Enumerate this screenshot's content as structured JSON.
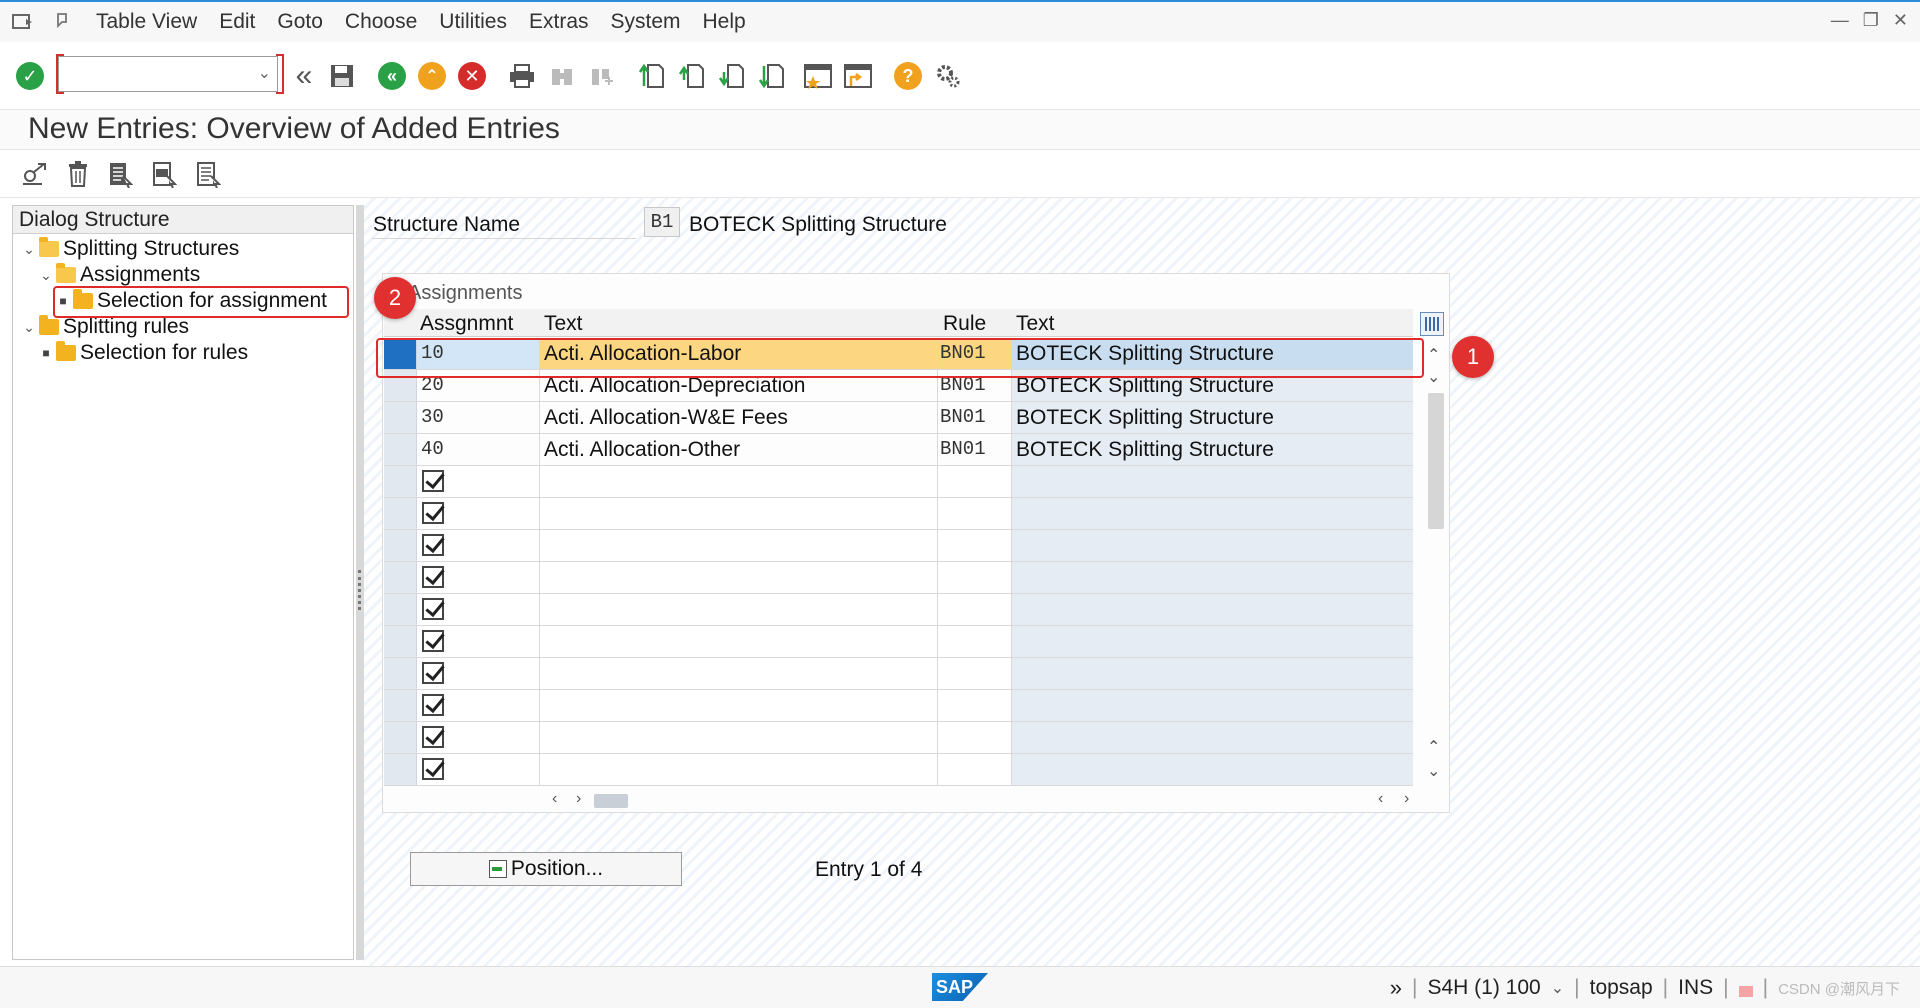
{
  "menu": {
    "items": [
      {
        "label": "Table View"
      },
      {
        "label": "Edit"
      },
      {
        "label": "Goto"
      },
      {
        "label": "Choose"
      },
      {
        "label": "Utilities"
      },
      {
        "label": "Extras"
      },
      {
        "label": "System"
      },
      {
        "label": "Help"
      }
    ]
  },
  "toolbar": {
    "command_value": "",
    "icons": [
      "enter-icon",
      "back-double-icon",
      "save-icon",
      "back-icon",
      "exit-icon",
      "cancel-icon",
      "print-icon",
      "find-icon",
      "find-next-icon",
      "first-page-icon",
      "previous-page-icon",
      "next-page-icon",
      "last-page-icon",
      "create-session-icon",
      "shortcut-icon",
      "help-icon",
      "customize-layout-icon"
    ]
  },
  "page": {
    "title": "New Entries: Overview of Added Entries"
  },
  "toolbar2": {
    "icons": [
      "display-change-icon",
      "delete-icon",
      "select-all-icon",
      "select-block-icon",
      "deselect-all-icon"
    ]
  },
  "dialog_structure": {
    "header": "Dialog Structure",
    "nodes": [
      {
        "label": "Splitting Structures"
      },
      {
        "label": "Assignments"
      },
      {
        "label": "Selection for assignment"
      },
      {
        "label": "Splitting rules"
      },
      {
        "label": "Selection for rules"
      }
    ]
  },
  "structure": {
    "label": "Structure Name",
    "code": "B1",
    "name": "BOTECK  Splitting Structure"
  },
  "table": {
    "caption": "Assignments",
    "columns": [
      "Assgnmnt",
      "Text",
      "Rule",
      "Text"
    ],
    "rows": [
      {
        "assgnmnt": "10",
        "text": "Acti. Allocation-Labor",
        "rule": "BN01",
        "rule_text": "BOTECK Splitting Structure"
      },
      {
        "assgnmnt": "20",
        "text": "Acti. Allocation-Depreciation",
        "rule": "BN01",
        "rule_text": "BOTECK Splitting Structure"
      },
      {
        "assgnmnt": "30",
        "text": "Acti. Allocation-W&E Fees",
        "rule": "BN01",
        "rule_text": "BOTECK Splitting Structure"
      },
      {
        "assgnmnt": "40",
        "text": "Acti. Allocation-Other",
        "rule": "BN01",
        "rule_text": "BOTECK Splitting Structure"
      }
    ],
    "empty_rows": 10
  },
  "position_button": {
    "label": "Position..."
  },
  "entry_info": "Entry 1 of 4",
  "callouts": [
    "1",
    "2"
  ],
  "statusbar": {
    "logo": "SAP",
    "system": "S4H (1) 100",
    "host": "topsap",
    "mode": "INS",
    "watermark": "CSDN @潮风月下"
  },
  "colors": {
    "accent": "#2a8fd8",
    "highlight_row": "#fcd681",
    "callout": "#e03030",
    "enter_green": "#2aa146",
    "cancel_red": "#d62b2b",
    "exit_orange": "#f0a21f"
  }
}
